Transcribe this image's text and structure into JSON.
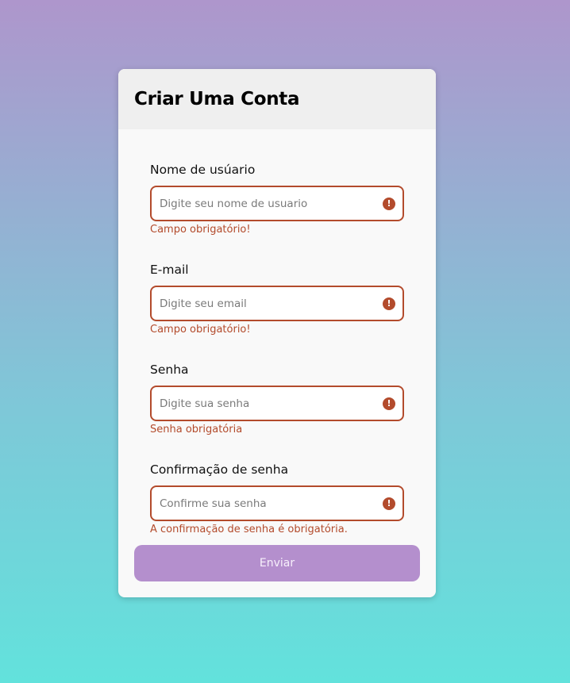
{
  "form": {
    "title": "Criar Uma Conta",
    "fields": [
      {
        "label": "Nome de usúario",
        "placeholder": "Digite seu nome de usuario",
        "value": "",
        "error": "Campo obrigatório!"
      },
      {
        "label": "E-mail",
        "placeholder": "Digite seu email",
        "value": "",
        "error": "Campo obrigatório!"
      },
      {
        "label": "Senha",
        "placeholder": "Digite sua senha",
        "value": "",
        "error": "Senha obrigatória"
      },
      {
        "label": "Confirmação de senha",
        "placeholder": "Confirme sua senha",
        "value": "",
        "error": "A confirmação de senha é obrigatória."
      }
    ],
    "submit_label": "Enviar"
  },
  "icons": {
    "field_error": "alert-circle-icon"
  },
  "colors": {
    "error": "#b34b2c",
    "button": "#b48fcd",
    "gradient_top": "#ae96cc",
    "gradient_bottom": "#62e2dc"
  }
}
